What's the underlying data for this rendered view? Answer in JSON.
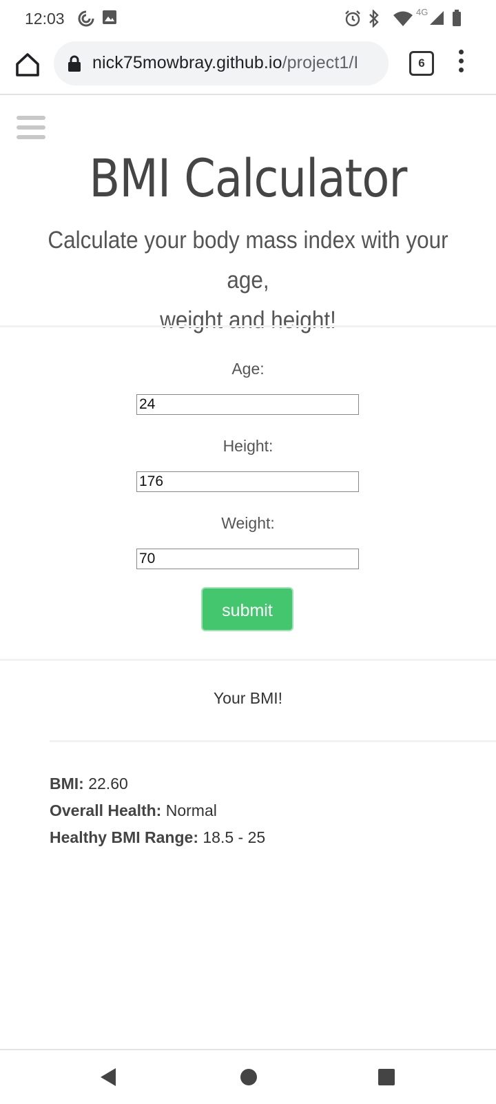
{
  "status_bar": {
    "time": "12:03",
    "network_label": "4G",
    "icons": [
      "sync-icon",
      "image-icon",
      "alarm-icon",
      "bluetooth-icon",
      "wifi-icon",
      "cell-signal-icon",
      "battery-icon"
    ]
  },
  "browser": {
    "url_host": "nick75mowbray.github.io",
    "url_path": "/project1/I",
    "tab_count": "6"
  },
  "page": {
    "title": "BMI Calculator",
    "subtitle_line1": "Calculate your body mass index with your age,",
    "subtitle_line2": "weight and height!"
  },
  "form": {
    "age_label": "Age:",
    "age_value": "24",
    "height_label": "Height:",
    "height_value": "176",
    "weight_label": "Weight:",
    "weight_value": "70",
    "submit_label": "submit"
  },
  "result": {
    "heading": "Your BMI!",
    "bmi_label": "BMI:",
    "bmi_value": "22.60",
    "health_label": "Overall Health:",
    "health_value": "Normal",
    "range_label": "Healthy BMI Range:",
    "range_value": "18.5 - 25"
  },
  "colors": {
    "submit_button": "#43c66d",
    "url_bar_bg": "#f1f3f4"
  }
}
